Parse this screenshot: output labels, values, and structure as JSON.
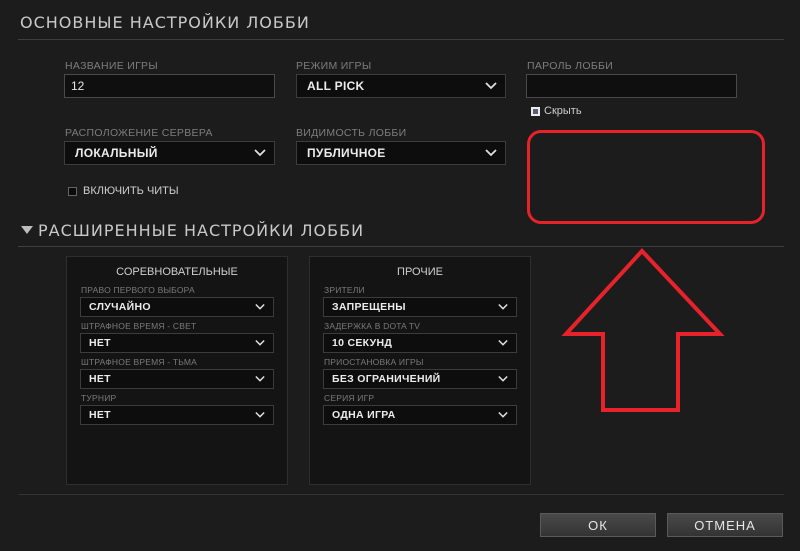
{
  "basic": {
    "title": "ОСНОВНЫЕ НАСТРОЙКИ ЛОББИ",
    "game_name_label": "НАЗВАНИЕ ИГРЫ",
    "game_name_value": "12",
    "game_mode_label": "РЕЖИМ ИГРЫ",
    "game_mode_value": "ALL PICK",
    "password_label": "ПАРОЛЬ ЛОББИ",
    "password_value": "",
    "hide_label": "Скрыть",
    "server_label": "РАСПОЛОЖЕНИЕ СЕРВЕРА",
    "server_value": "ЛОКАЛЬНЫЙ",
    "visibility_label": "ВИДИМОСТЬ ЛОББИ",
    "visibility_value": "ПУБЛИЧНОЕ",
    "cheats_label": "ВКЛЮЧИТЬ ЧИТЫ"
  },
  "advanced": {
    "title": "РАСШИРЕННЫЕ НАСТРОЙКИ ЛОББИ",
    "competitive": {
      "title": "СОРЕВНОВАТЕЛЬНЫЕ",
      "first_pick_label": "ПРАВО ПЕРВОГО ВЫБОРА",
      "first_pick_value": "СЛУЧАЙНО",
      "penalty_radiant_label": "ШТРАФНОЕ ВРЕМЯ - СВЕТ",
      "penalty_radiant_value": "НЕТ",
      "penalty_dire_label": "ШТРАФНОЕ ВРЕМЯ - ТЬМА",
      "penalty_dire_value": "НЕТ",
      "tournament_label": "ТУРНИР",
      "tournament_value": "НЕТ"
    },
    "other": {
      "title": "ПРОЧИЕ",
      "spectators_label": "ЗРИТЕЛИ",
      "spectators_value": "ЗАПРЕЩЕНЫ",
      "delay_label": "ЗАДЕРЖКА В DOTA TV",
      "delay_value": "10 СЕКУНД",
      "pause_label": "ПРИОСТАНОВКА ИГРЫ",
      "pause_value": "БЕЗ ОГРАНИЧЕНИЙ",
      "series_label": "СЕРИЯ ИГР",
      "series_value": "ОДНА ИГРА"
    }
  },
  "footer": {
    "ok_label": "ОК",
    "cancel_label": "ОТМЕНА"
  },
  "colors": {
    "annotation_red": "#e8222a",
    "background": "#1c1c1c"
  }
}
